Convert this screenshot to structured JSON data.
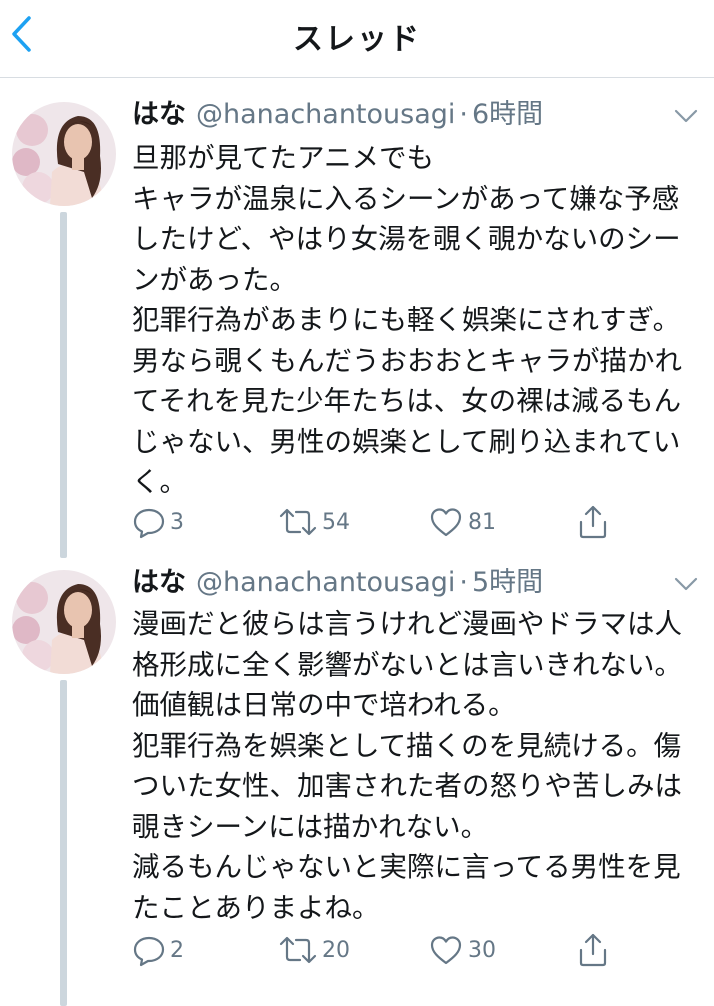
{
  "header": {
    "title": "スレッド"
  },
  "tweets": [
    {
      "name": "はな",
      "handle": "@hanachantousagi",
      "separator": "·",
      "time": "6時間",
      "text": "旦那が見てたアニメでも\nキャラが温泉に入るシーンがあって嫌な予感\nしたけど、やはり女湯を覗く覗かないのシー\nンがあった。\n犯罪行為があまりにも軽く娯楽にされすぎ。\n男なら覗くもんだうおおおとキャラが描かれ\nてそれを見た少年たちは、女の裸は減るもん\nじゃない、男性の娯楽として刷り込まれてい\nく。",
      "replies": "3",
      "retweets": "54",
      "likes": "81"
    },
    {
      "name": "はな",
      "handle": "@hanachantousagi",
      "separator": "·",
      "time": "5時間",
      "text": "漫画だと彼らは言うけれど漫画やドラマは人\n格形成に全く影響がないとは言いきれない。\n価値観は日常の中で培われる。\n犯罪行為を娯楽として描くのを見続ける。傷\nついた女性、加害された者の怒りや苦しみは\n覗きシーンには描かれない。\n減るもんじゃないと実際に言ってる男性を見\nたことありまよね。",
      "replies": "2",
      "retweets": "20",
      "likes": "30"
    }
  ],
  "colors": {
    "accent": "#1da1f2",
    "muted": "#657786",
    "text": "#14171a",
    "thread_line": "#ccd6dd",
    "border": "#d8dde2"
  },
  "icons": [
    "chevron-left-icon",
    "chevron-down-icon",
    "reply-icon",
    "retweet-icon",
    "like-icon",
    "share-icon"
  ]
}
